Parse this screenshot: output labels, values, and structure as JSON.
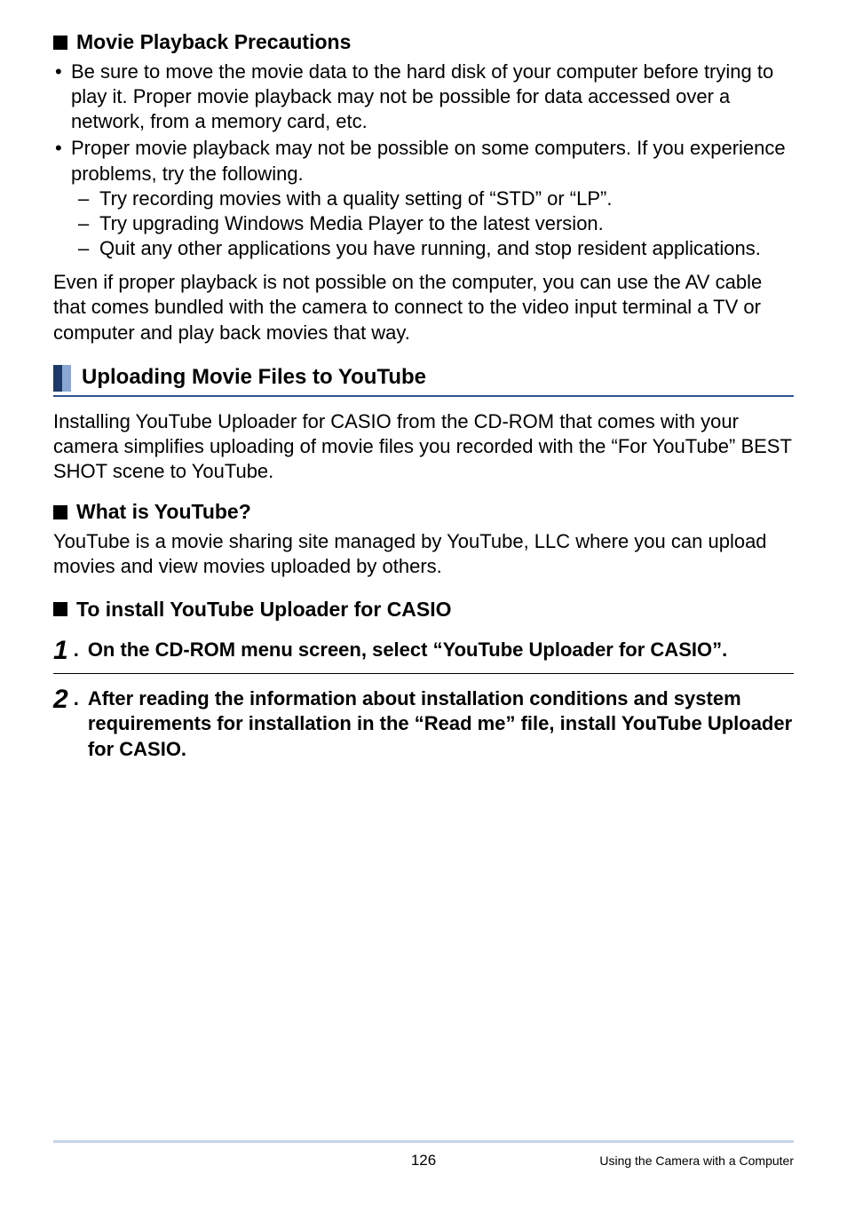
{
  "section1": {
    "title": "Movie Playback Precautions",
    "bullets": [
      {
        "text": "Be sure to move the movie data to the hard disk of your computer before trying to play it. Proper movie playback may not be possible for data accessed over a network, from a memory card, etc."
      },
      {
        "text": "Proper movie playback may not be possible on some computers. If you experience problems, try the following.",
        "dashes": [
          "Try recording movies with a quality setting of “STD” or “LP”.",
          "Try upgrading Windows Media Player to the latest version.",
          "Quit any other applications you have running, and stop resident applications."
        ]
      }
    ],
    "after": "Even if proper playback is not possible on the computer, you can use the AV cable that comes bundled with the camera to connect to the video input terminal a TV or computer and play back movies that way."
  },
  "blueheader": "Uploading Movie Files to YouTube",
  "intro2": "Installing YouTube Uploader for CASIO from the CD-ROM that comes with your camera simplifies uploading of movie files you recorded with the “For YouTube” BEST SHOT scene to YouTube.",
  "section2": {
    "title": "What is YouTube?",
    "body": "YouTube is a movie sharing site managed by YouTube, LLC where you can upload movies and view movies uploaded by others."
  },
  "section3": {
    "title": "To install YouTube Uploader for CASIO"
  },
  "steps": [
    {
      "num": "1",
      "text": "On the CD-ROM menu screen, select “YouTube Uploader for CASIO”."
    },
    {
      "num": "2",
      "text": "After reading the information about installation conditions and system requirements for installation in the “Read me” file, install YouTube Uploader for CASIO."
    }
  ],
  "footer": {
    "page": "126",
    "right": "Using the Camera with a Computer"
  }
}
